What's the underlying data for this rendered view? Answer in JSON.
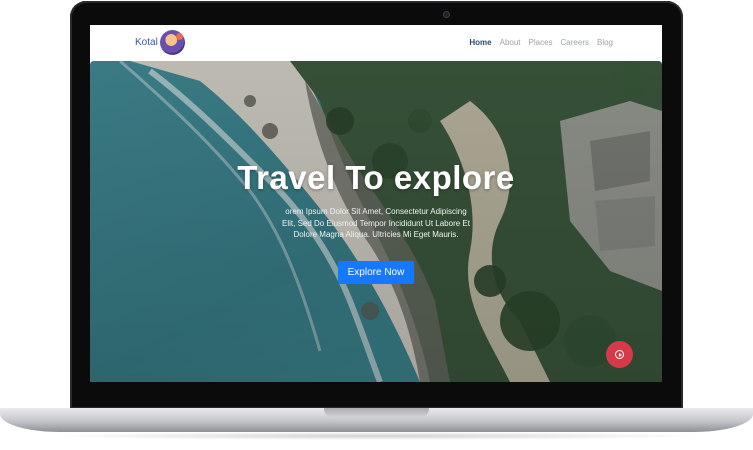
{
  "nav": {
    "brand": "Kotal",
    "links": [
      "Home",
      "About",
      "Places",
      "Careers",
      "Blog"
    ],
    "active": "Home"
  },
  "hero": {
    "title": "Travel To explore",
    "description": "orem Ipsum Dolor Sit Amet, Consectetur Adipiscing Elit, Sed Do Eiusmod Tempor Incididunt Ut Labore Et Dolore Magna Aliqua. Ultricies Mi Eget Mauris.",
    "cta_label": "Explore Now"
  },
  "icons": {
    "avatar": "avatar-illustration",
    "play": "play-circle-icon",
    "camera": "camera-dot"
  },
  "colors": {
    "cta": "#1677ff",
    "play_button": "#d63a48",
    "nav_active": "#2d4a6b",
    "nav_link": "#9aa4ad"
  }
}
